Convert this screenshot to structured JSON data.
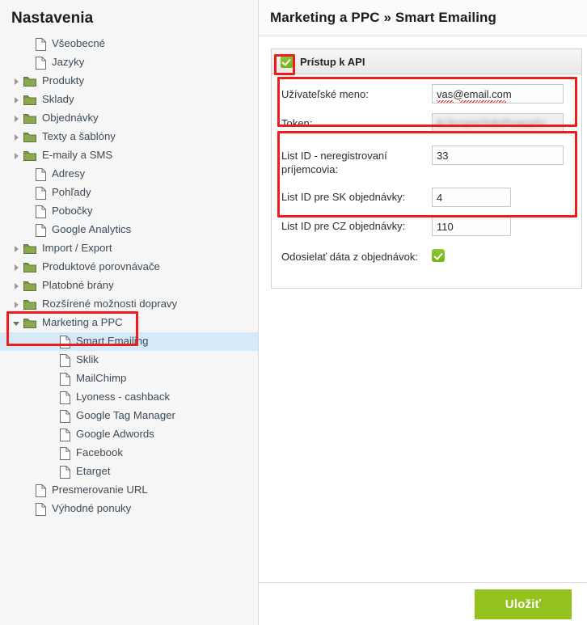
{
  "sidebar": {
    "title": "Nastavenia",
    "items": [
      {
        "label": "Všeobecné",
        "type": "file",
        "level": 1,
        "expander": "none"
      },
      {
        "label": "Jazyky",
        "type": "file",
        "level": 1,
        "expander": "none"
      },
      {
        "label": "Produkty",
        "type": "folder",
        "level": 1,
        "expander": "closed"
      },
      {
        "label": "Sklady",
        "type": "folder",
        "level": 1,
        "expander": "closed"
      },
      {
        "label": "Objednávky",
        "type": "folder",
        "level": 1,
        "expander": "closed"
      },
      {
        "label": "Texty a šablóny",
        "type": "folder",
        "level": 1,
        "expander": "closed"
      },
      {
        "label": "E-maily a SMS",
        "type": "folder",
        "level": 1,
        "expander": "closed"
      },
      {
        "label": "Adresy",
        "type": "file",
        "level": 1,
        "expander": "none"
      },
      {
        "label": "Pohľady",
        "type": "file",
        "level": 1,
        "expander": "none"
      },
      {
        "label": "Pobočky",
        "type": "file",
        "level": 1,
        "expander": "none"
      },
      {
        "label": "Google Analytics",
        "type": "file",
        "level": 1,
        "expander": "none"
      },
      {
        "label": "Import / Export",
        "type": "folder",
        "level": 1,
        "expander": "closed"
      },
      {
        "label": "Produktové porovnávače",
        "type": "folder",
        "level": 1,
        "expander": "closed"
      },
      {
        "label": "Platobné brány",
        "type": "folder",
        "level": 1,
        "expander": "closed"
      },
      {
        "label": "Rozšírené možnosti dopravy",
        "type": "folder",
        "level": 1,
        "expander": "closed"
      },
      {
        "label": "Marketing a PPC",
        "type": "folder",
        "level": 1,
        "expander": "open"
      },
      {
        "label": "Smart Emailing",
        "type": "file",
        "level": 2,
        "expander": "none",
        "selected": true
      },
      {
        "label": "Sklik",
        "type": "file",
        "level": 2,
        "expander": "none"
      },
      {
        "label": "MailChimp",
        "type": "file",
        "level": 2,
        "expander": "none"
      },
      {
        "label": "Lyoness - cashback",
        "type": "file",
        "level": 2,
        "expander": "none"
      },
      {
        "label": "Google Tag Manager",
        "type": "file",
        "level": 2,
        "expander": "none"
      },
      {
        "label": "Google Adwords",
        "type": "file",
        "level": 2,
        "expander": "none"
      },
      {
        "label": "Facebook",
        "type": "file",
        "level": 2,
        "expander": "none"
      },
      {
        "label": "Etarget",
        "type": "file",
        "level": 2,
        "expander": "none"
      },
      {
        "label": "Presmerovanie URL",
        "type": "file",
        "level": 1,
        "expander": "none"
      },
      {
        "label": "Výhodné ponuky",
        "type": "file",
        "level": 1,
        "expander": "none"
      }
    ]
  },
  "header": {
    "title": "Marketing a PPC » Smart Emailing"
  },
  "panel": {
    "title": "Prístup k API",
    "enabled_checkbox": true,
    "fields": {
      "username_label": "Užívateľské meno:",
      "username_value": "vas@email.com",
      "token_label": "Token:",
      "token_value": "4c3scqvwTe8oPuwsqXc",
      "list_unregistered_label": "List ID - neregistrovaní príjemcovia:",
      "list_unregistered_value": "33",
      "list_sk_label": "List ID pre SK objednávky:",
      "list_sk_value": "4",
      "list_cz_label": "List ID pre CZ objednávky:",
      "list_cz_value": "110",
      "send_orders_label": "Odosielať dáta z objednávok:",
      "send_orders_checked": true
    }
  },
  "footer": {
    "save_label": "Uložiť"
  },
  "colors": {
    "accent_green": "#95c11f",
    "checkbox_green": "#7cb518",
    "annotation_red": "#ee1c1c",
    "selection_blue": "#d6e9f8",
    "sidebar_bg": "#f6f6f6",
    "folder_green": "#8aa850"
  }
}
